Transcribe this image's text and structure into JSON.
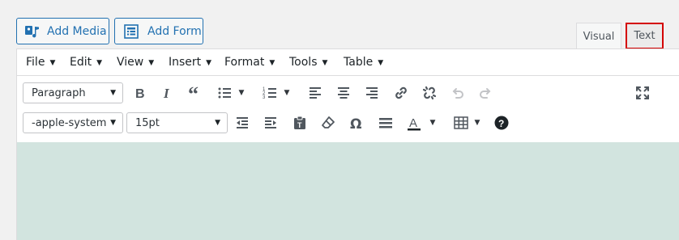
{
  "media_buttons": {
    "add_media": "Add Media",
    "add_form": "Add Form"
  },
  "tabs": {
    "visual": "Visual",
    "text": "Text"
  },
  "menubar": {
    "items": [
      "File",
      "Edit",
      "View",
      "Insert",
      "Format",
      "Tools",
      "Table"
    ]
  },
  "toolbar": {
    "row1": {
      "format_select": "Paragraph",
      "buttons": [
        "bold-icon",
        "italic-icon",
        "blockquote-icon",
        "bullet-list-icon",
        "numbered-list-icon",
        "align-left-icon",
        "align-center-icon",
        "align-right-icon",
        "link-icon",
        "unlink-icon",
        "undo-icon",
        "redo-icon",
        "fullscreen-icon"
      ]
    },
    "row2": {
      "font_family_select": "-apple-system",
      "font_size_select": "15pt",
      "buttons": [
        "outdent-icon",
        "indent-icon",
        "paste-text-icon",
        "clear-formatting-icon",
        "special-character-icon",
        "horizontal-line-icon",
        "text-color-icon",
        "table-icon",
        "help-icon"
      ]
    }
  },
  "colors": {
    "accent": "#2271b1",
    "highlight_border": "#d40000",
    "content_background": "#d2e4df"
  }
}
